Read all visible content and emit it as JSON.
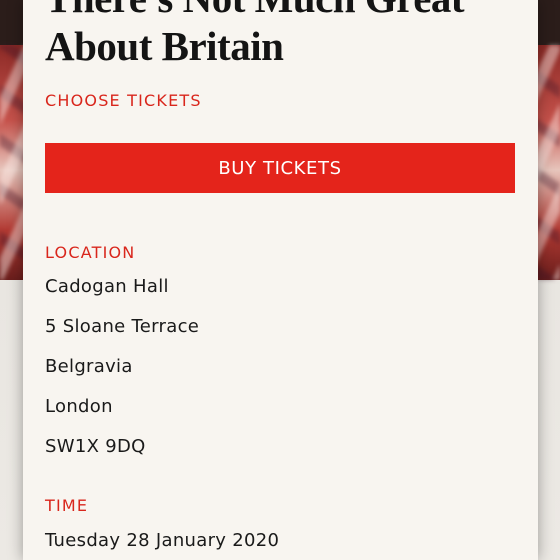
{
  "event": {
    "title": "There's Not Much Great About Britain",
    "choose_tickets_label": "CHOOSE TICKETS",
    "buy_button_label": "BUY TICKETS"
  },
  "location": {
    "label": "LOCATION",
    "lines": [
      "Cadogan Hall",
      "5 Sloane Terrace",
      "Belgravia",
      "London",
      "SW1X 9DQ"
    ]
  },
  "time": {
    "label": "TIME",
    "value": "Tuesday 28 January 2020"
  },
  "colors": {
    "accent": "#e4241b",
    "card_background": "#f8f5f0",
    "text": "#1a1a1a"
  }
}
